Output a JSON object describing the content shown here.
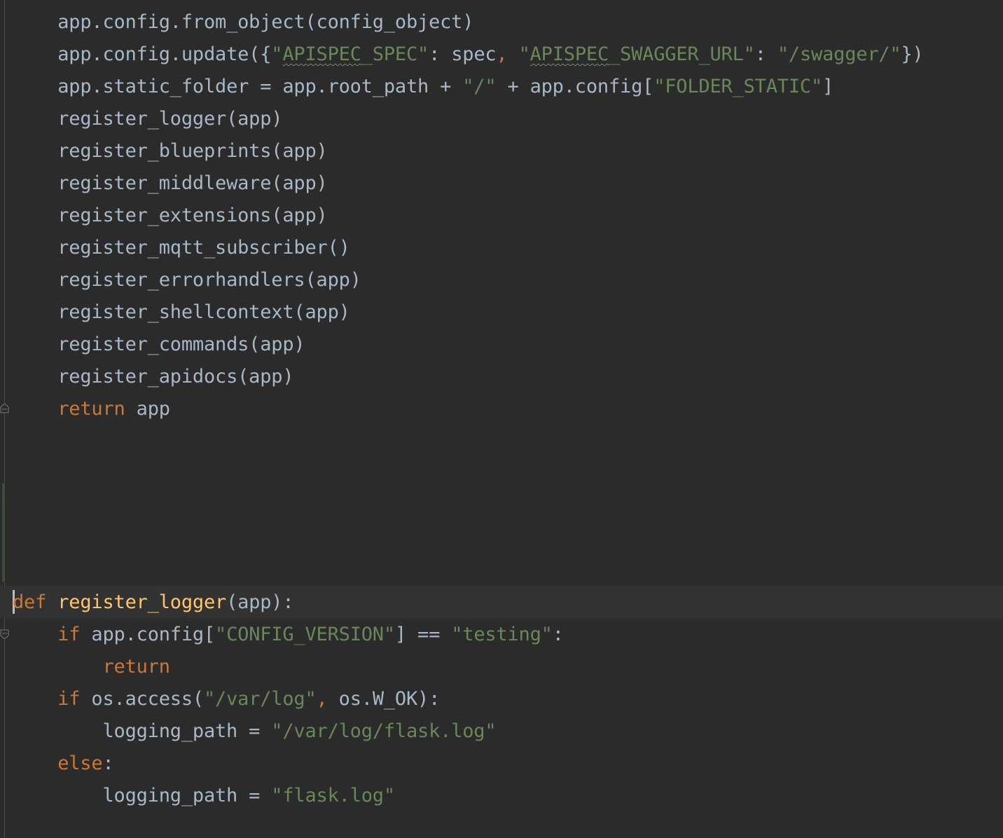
{
  "editor": {
    "lines": [
      {
        "indent": "    ",
        "tokens": [
          {
            "t": "app.config.from_object(config_object)",
            "c": "plain"
          }
        ]
      },
      {
        "indent": "    ",
        "tokens": [
          {
            "t": "app.config.update({",
            "c": "plain"
          },
          {
            "t": "\"",
            "c": "str"
          },
          {
            "t": "APISPEC",
            "c": "str typo"
          },
          {
            "t": "_SPEC\"",
            "c": "str"
          },
          {
            "t": ": spec",
            "c": "plain"
          },
          {
            "t": ", ",
            "c": "kw"
          },
          {
            "t": "\"",
            "c": "str"
          },
          {
            "t": "APISPEC",
            "c": "str typo"
          },
          {
            "t": "_SWAGGER_URL\"",
            "c": "str"
          },
          {
            "t": ": ",
            "c": "plain"
          },
          {
            "t": "\"/swagger/\"",
            "c": "str"
          },
          {
            "t": "})",
            "c": "plain"
          }
        ]
      },
      {
        "indent": "    ",
        "tokens": [
          {
            "t": "app.static_folder = app.root_path + ",
            "c": "plain"
          },
          {
            "t": "\"/\"",
            "c": "str"
          },
          {
            "t": " + app.config[",
            "c": "plain"
          },
          {
            "t": "\"FOLDER_STATIC\"",
            "c": "str"
          },
          {
            "t": "]",
            "c": "plain"
          }
        ]
      },
      {
        "indent": "    ",
        "tokens": [
          {
            "t": "register_logger(app)",
            "c": "plain"
          }
        ]
      },
      {
        "indent": "    ",
        "tokens": [
          {
            "t": "register_blueprints(app)",
            "c": "plain"
          }
        ]
      },
      {
        "indent": "    ",
        "tokens": [
          {
            "t": "register_middleware(app)",
            "c": "plain"
          }
        ]
      },
      {
        "indent": "    ",
        "tokens": [
          {
            "t": "register_extensions(app)",
            "c": "plain"
          }
        ]
      },
      {
        "indent": "    ",
        "tokens": [
          {
            "t": "register_mqtt_subscriber()",
            "c": "plain"
          }
        ]
      },
      {
        "indent": "    ",
        "tokens": [
          {
            "t": "register_errorhandlers(app)",
            "c": "plain"
          }
        ]
      },
      {
        "indent": "    ",
        "tokens": [
          {
            "t": "register_shellcontext(app)",
            "c": "plain"
          }
        ]
      },
      {
        "indent": "    ",
        "tokens": [
          {
            "t": "register_commands(app)",
            "c": "plain"
          }
        ]
      },
      {
        "indent": "    ",
        "tokens": [
          {
            "t": "register_apidocs(app)",
            "c": "plain"
          }
        ]
      },
      {
        "indent": "    ",
        "tokens": [
          {
            "t": "return",
            "c": "kw"
          },
          {
            "t": " app",
            "c": "plain"
          }
        ]
      },
      {
        "indent": "",
        "tokens": []
      },
      {
        "indent": "",
        "tokens": []
      },
      {
        "indent": "",
        "tokens": []
      },
      {
        "indent": "",
        "tokens": []
      },
      {
        "indent": "",
        "tokens": []
      },
      {
        "indent": "",
        "tokens": [
          {
            "t": "def",
            "c": "kw"
          },
          {
            "t": " ",
            "c": "plain"
          },
          {
            "t": "register_logger",
            "c": "fn"
          },
          {
            "t": "(app):",
            "c": "plain"
          }
        ]
      },
      {
        "indent": "    ",
        "tokens": [
          {
            "t": "if",
            "c": "kw"
          },
          {
            "t": " app.config[",
            "c": "plain"
          },
          {
            "t": "\"CONFIG_VERSION\"",
            "c": "str"
          },
          {
            "t": "] == ",
            "c": "plain"
          },
          {
            "t": "\"testing\"",
            "c": "str"
          },
          {
            "t": ":",
            "c": "plain"
          }
        ]
      },
      {
        "indent": "        ",
        "tokens": [
          {
            "t": "return",
            "c": "kw"
          }
        ]
      },
      {
        "indent": "    ",
        "tokens": [
          {
            "t": "if",
            "c": "kw"
          },
          {
            "t": " os.access(",
            "c": "plain"
          },
          {
            "t": "\"/var/log\"",
            "c": "str"
          },
          {
            "t": ", ",
            "c": "kw"
          },
          {
            "t": "os.W_OK):",
            "c": "plain"
          }
        ]
      },
      {
        "indent": "        ",
        "tokens": [
          {
            "t": "logging_path = ",
            "c": "plain"
          },
          {
            "t": "\"/var/log/flask.log\"",
            "c": "str"
          }
        ]
      },
      {
        "indent": "    ",
        "tokens": [
          {
            "t": "else",
            "c": "kw"
          },
          {
            "t": ":",
            "c": "plain"
          }
        ]
      },
      {
        "indent": "        ",
        "tokens": [
          {
            "t": "logging_path = ",
            "c": "plain"
          },
          {
            "t": "\"flask.log\"",
            "c": "str"
          }
        ]
      }
    ]
  }
}
